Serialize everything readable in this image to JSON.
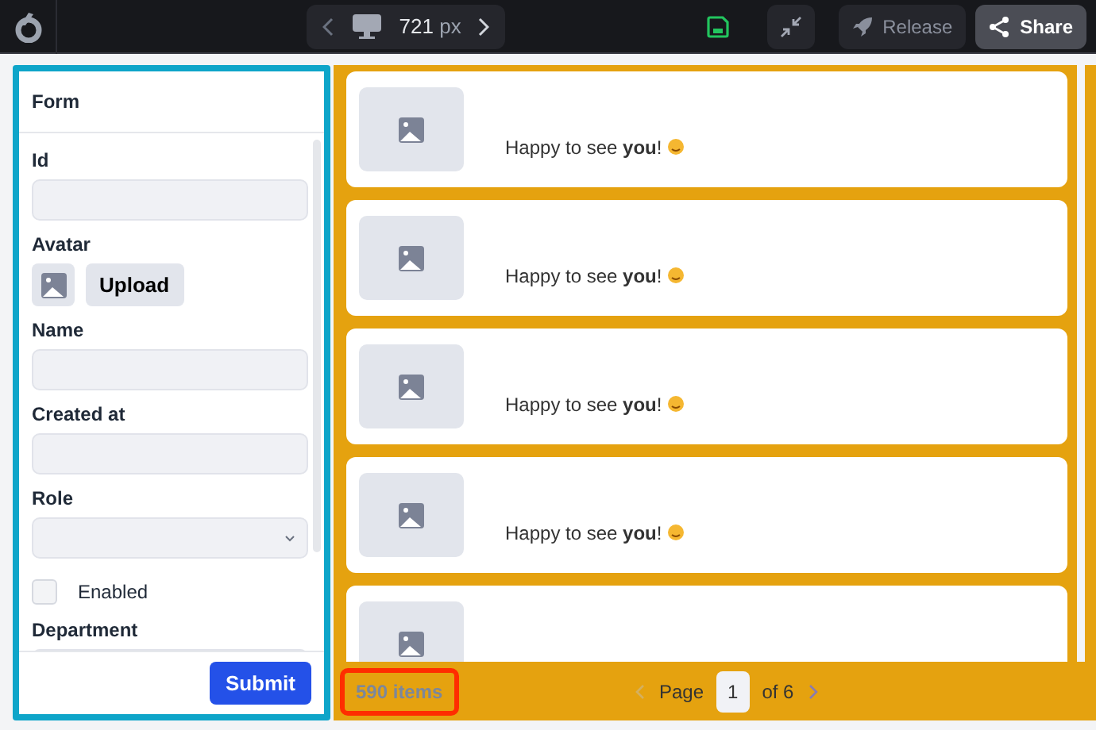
{
  "toolbar": {
    "width_value": "721",
    "width_unit": "px",
    "buttons": [
      {
        "kind": "save"
      },
      {
        "kind": "collapse"
      },
      {
        "kind": "release",
        "label": "Release"
      },
      {
        "kind": "share",
        "label": "Share"
      }
    ]
  },
  "form": {
    "title": "Form",
    "fields": [
      {
        "kind": "text",
        "label": "Id"
      },
      {
        "kind": "avatar",
        "label": "Avatar",
        "button": "Upload"
      },
      {
        "kind": "text",
        "label": "Name"
      },
      {
        "kind": "text",
        "label": "Created at"
      },
      {
        "kind": "select",
        "label": "Role"
      },
      {
        "kind": "checkbox",
        "label": "Enabled",
        "checked": false
      },
      {
        "kind": "text",
        "label": "Department"
      }
    ],
    "submit": "Submit"
  },
  "cards": [
    {
      "text": "Happy to see **you**!"
    },
    {
      "text": "Happy to see **you**!"
    },
    {
      "text": "Happy to see **you**!"
    },
    {
      "text": "Happy to see **you**!"
    },
    {
      "kind": "partial"
    }
  ],
  "footer": {
    "count": "590 items",
    "page_label": "Page",
    "page": "1",
    "of": "of 6"
  }
}
